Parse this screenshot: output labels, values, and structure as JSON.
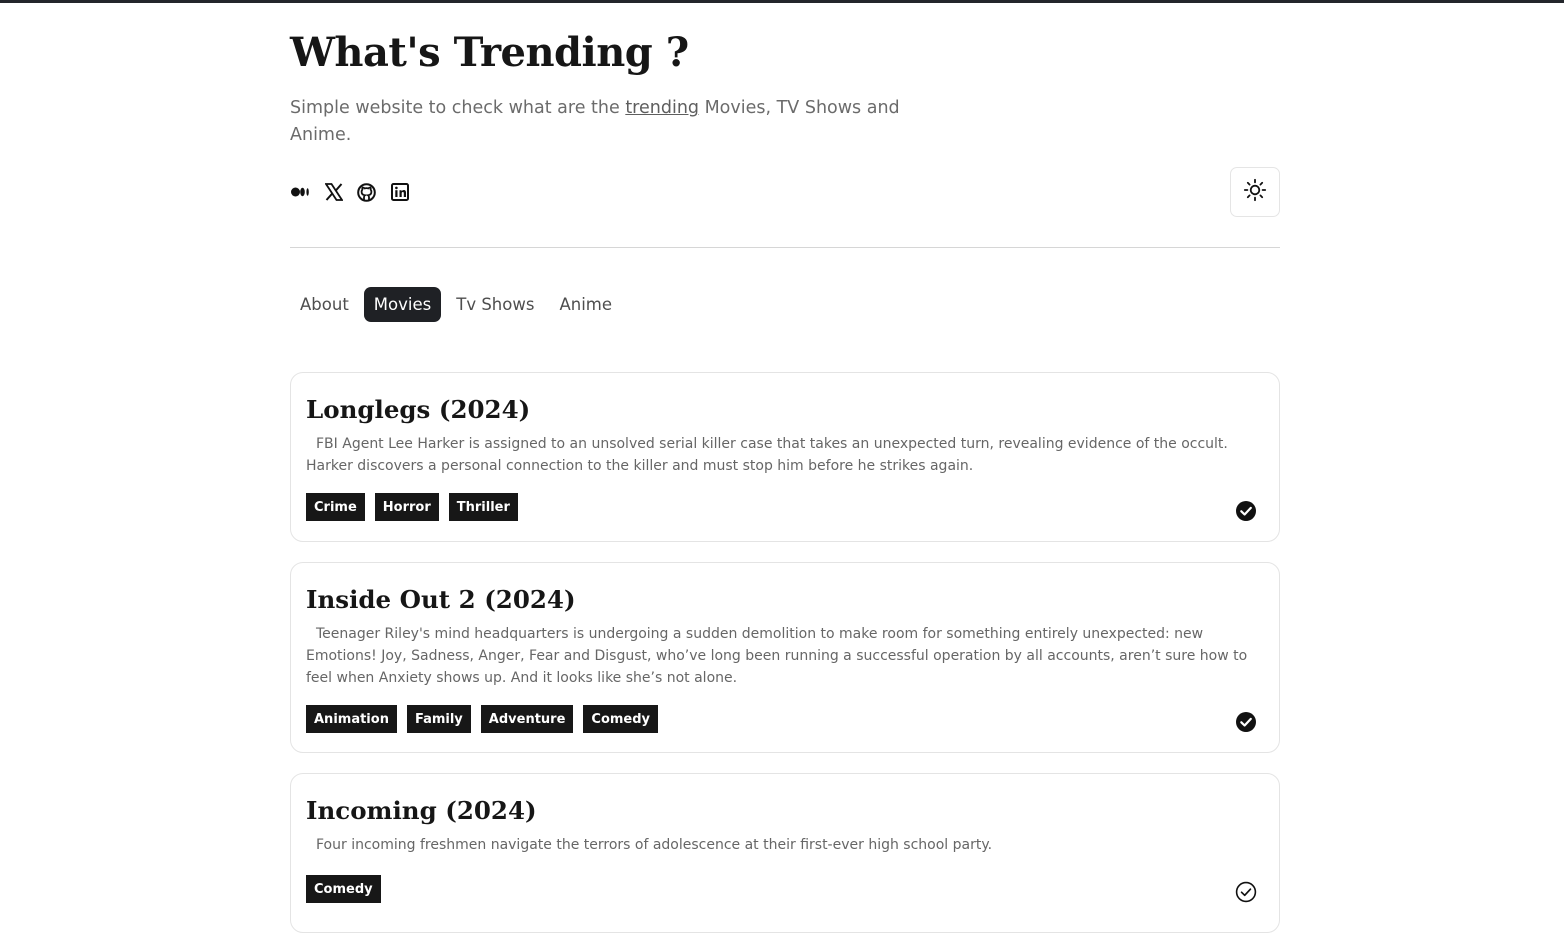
{
  "header": {
    "title": "What's Trending ?",
    "subtitle_before": "Simple website to check what are the ",
    "subtitle_link": "trending",
    "subtitle_after": " Movies, TV Shows and Anime."
  },
  "socials": [
    {
      "icon": "medium-icon"
    },
    {
      "icon": "x-icon"
    },
    {
      "icon": "github-icon"
    },
    {
      "icon": "linkedin-icon"
    }
  ],
  "theme_toggle": {
    "icon": "sun-icon"
  },
  "tabs": [
    {
      "label": "About"
    },
    {
      "label": "Movies",
      "active": true
    },
    {
      "label": "Tv Shows"
    },
    {
      "label": "Anime"
    }
  ],
  "movies": [
    {
      "title": "Longlegs (2024)",
      "description": "FBI Agent Lee Harker is assigned to an unsolved serial killer case that takes an unexpected turn, revealing evidence of the occult. Harker discovers a personal connection to the killer and must stop him before he strikes again.",
      "genres": [
        "Crime",
        "Horror",
        "Thriller"
      ],
      "checked": true
    },
    {
      "title": "Inside Out 2 (2024)",
      "description": "Teenager Riley's mind headquarters is undergoing a sudden demolition to make room for something entirely unexpected: new Emotions! Joy, Sadness, Anger, Fear and Disgust, who’ve long been running a successful operation by all accounts, aren’t sure how to feel when Anxiety shows up. And it looks like she’s not alone.",
      "genres": [
        "Animation",
        "Family",
        "Adventure",
        "Comedy"
      ],
      "checked": true
    },
    {
      "title": "Incoming (2024)",
      "description": "Four incoming freshmen navigate the terrors of adolescence at their first-ever high school party.",
      "genres": [
        "Comedy"
      ],
      "checked": false
    }
  ],
  "colors": {
    "accent": "#1f2125",
    "tag_bg": "#171717",
    "border": "#e4e4e4",
    "muted_text": "#666666"
  }
}
